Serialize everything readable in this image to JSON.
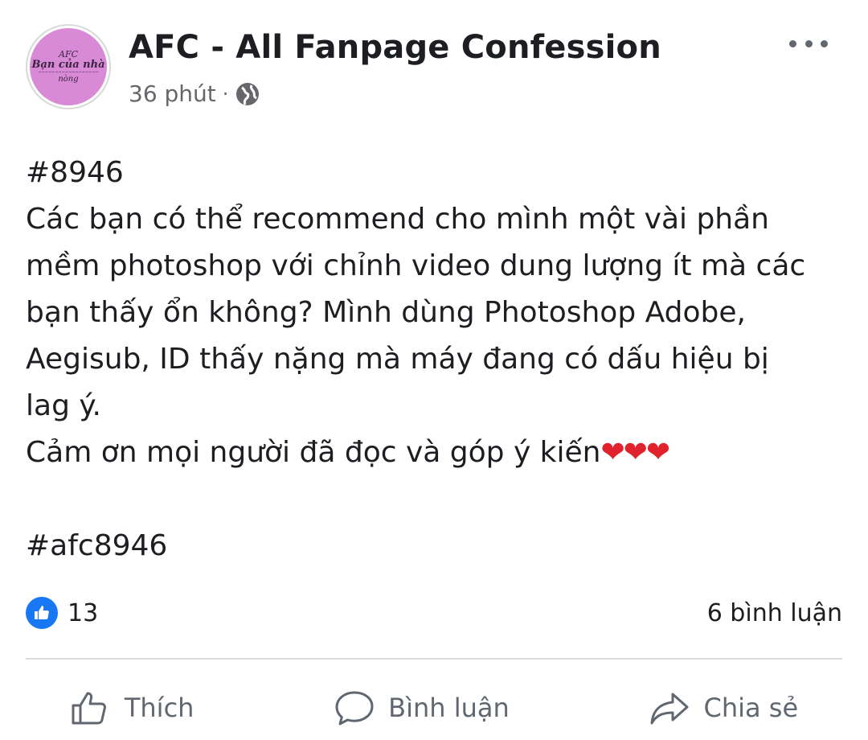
{
  "header": {
    "page_name": "AFC - All Fanpage Confession",
    "time": "36 phút",
    "separator": "·",
    "privacy_icon": "globe-icon",
    "more_icon": "more-dots-icon",
    "avatar": {
      "line1": "AFC",
      "line2": "Bạn của nhà",
      "line4": "nòng",
      "color": "#d98ad6"
    }
  },
  "post": {
    "lines": [
      "#8946",
      "Các bạn có thể recommend cho mình một vài phần",
      "mềm photoshop với chỉnh video dung lượng ít mà các",
      "bạn thấy ổn không? Mình dùng Photoshop Adobe,",
      "Aegisub, ID thấy nặng mà máy đang có dấu hiệu bị",
      "lag ý.",
      "Cảm ơn mọi người đã đọc và góp ý kiến"
    ],
    "hearts": "❤❤❤",
    "hashtag": "#afc8946"
  },
  "stats": {
    "likes": "13",
    "comments": "6 bình luận",
    "like_icon": "thumbs-up-icon",
    "accent": "#1877f2"
  },
  "actions": {
    "like": "Thích",
    "comment": "Bình luận",
    "share": "Chia sẻ"
  }
}
